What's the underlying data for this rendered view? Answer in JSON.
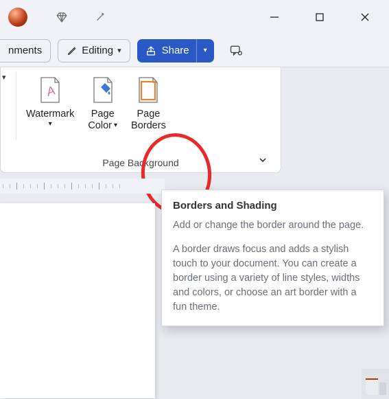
{
  "titlebar": {
    "sphere": "record-sphere",
    "diamond": "premium-diamond-icon",
    "wand": "magic-wand-icon"
  },
  "window_controls": {
    "minimize": "Minimize",
    "maximize": "Maximize",
    "close": "Close"
  },
  "upper": {
    "comments_label": "nments",
    "editing_label": "Editing",
    "share_label": "Share"
  },
  "group": {
    "watermark": {
      "line1": "Watermark"
    },
    "pagecolor": {
      "line1": "Page",
      "line2": "Color"
    },
    "pageborders": {
      "line1": "Page",
      "line2": "Borders"
    },
    "label": "Page Background"
  },
  "tooltip": {
    "title": "Borders and Shading",
    "p1": "Add or change the border around the page.",
    "p2": "A border draws focus and adds a stylish touch to your document. You can create a border using a variety of line styles, widths and colors, or choose an art border with a fun theme."
  }
}
